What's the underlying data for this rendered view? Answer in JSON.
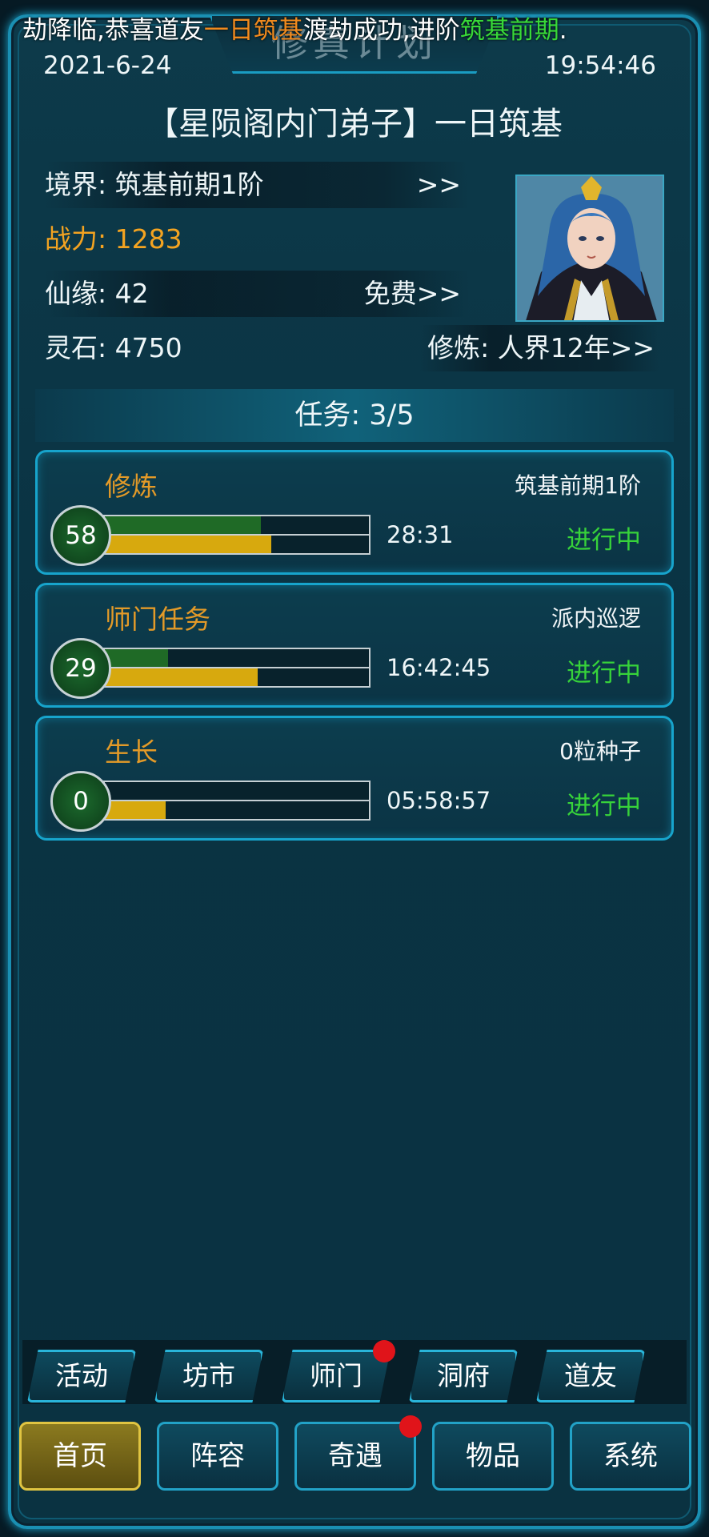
{
  "header": {
    "marquee_prefix": "劫降临,恭喜道友",
    "marquee_name": "一日筑基",
    "marquee_mid": "渡劫成功,进阶",
    "marquee_realm": "筑基前期",
    "marquee_end": ".",
    "title": "修真计划",
    "date": "2021-6-24",
    "time": "19:54:46"
  },
  "player": {
    "title": "【星陨阁内门弟子】一日筑基",
    "realm": "境界: 筑基前期1阶",
    "realm_link": ">>",
    "combat": "战力: 1283",
    "fate": "仙缘: 42",
    "fate_link": "免费>>",
    "stones": "灵石: 4750",
    "cultivation": "修炼: 人界12年>>"
  },
  "tasks": {
    "header": "任务: 3/5",
    "items": [
      {
        "name": "修炼",
        "desc": "筑基前期1阶",
        "level": "58",
        "time": "28:31",
        "status": "进行中",
        "green_progress": 0.59,
        "yellow_progress": 0.63
      },
      {
        "name": "师门任务",
        "desc": "派内巡逻",
        "level": "29",
        "time": "16:42:45",
        "status": "进行中",
        "green_progress": 0.24,
        "yellow_progress": 0.58
      },
      {
        "name": "生长",
        "desc": "0粒种子",
        "level": "0",
        "time": "05:58:57",
        "status": "进行中",
        "green_progress": 0.0,
        "yellow_progress": 0.23
      }
    ]
  },
  "sub_nav": [
    "活动",
    "坊市",
    "师门",
    "洞府",
    "道友"
  ],
  "bottom_nav": [
    "首页",
    "阵容",
    "奇遇",
    "物品",
    "系统"
  ],
  "colors": {
    "accent": "#1a9cc2",
    "orange": "#e39a28",
    "green": "#37d33a",
    "active": "#e0c441"
  }
}
